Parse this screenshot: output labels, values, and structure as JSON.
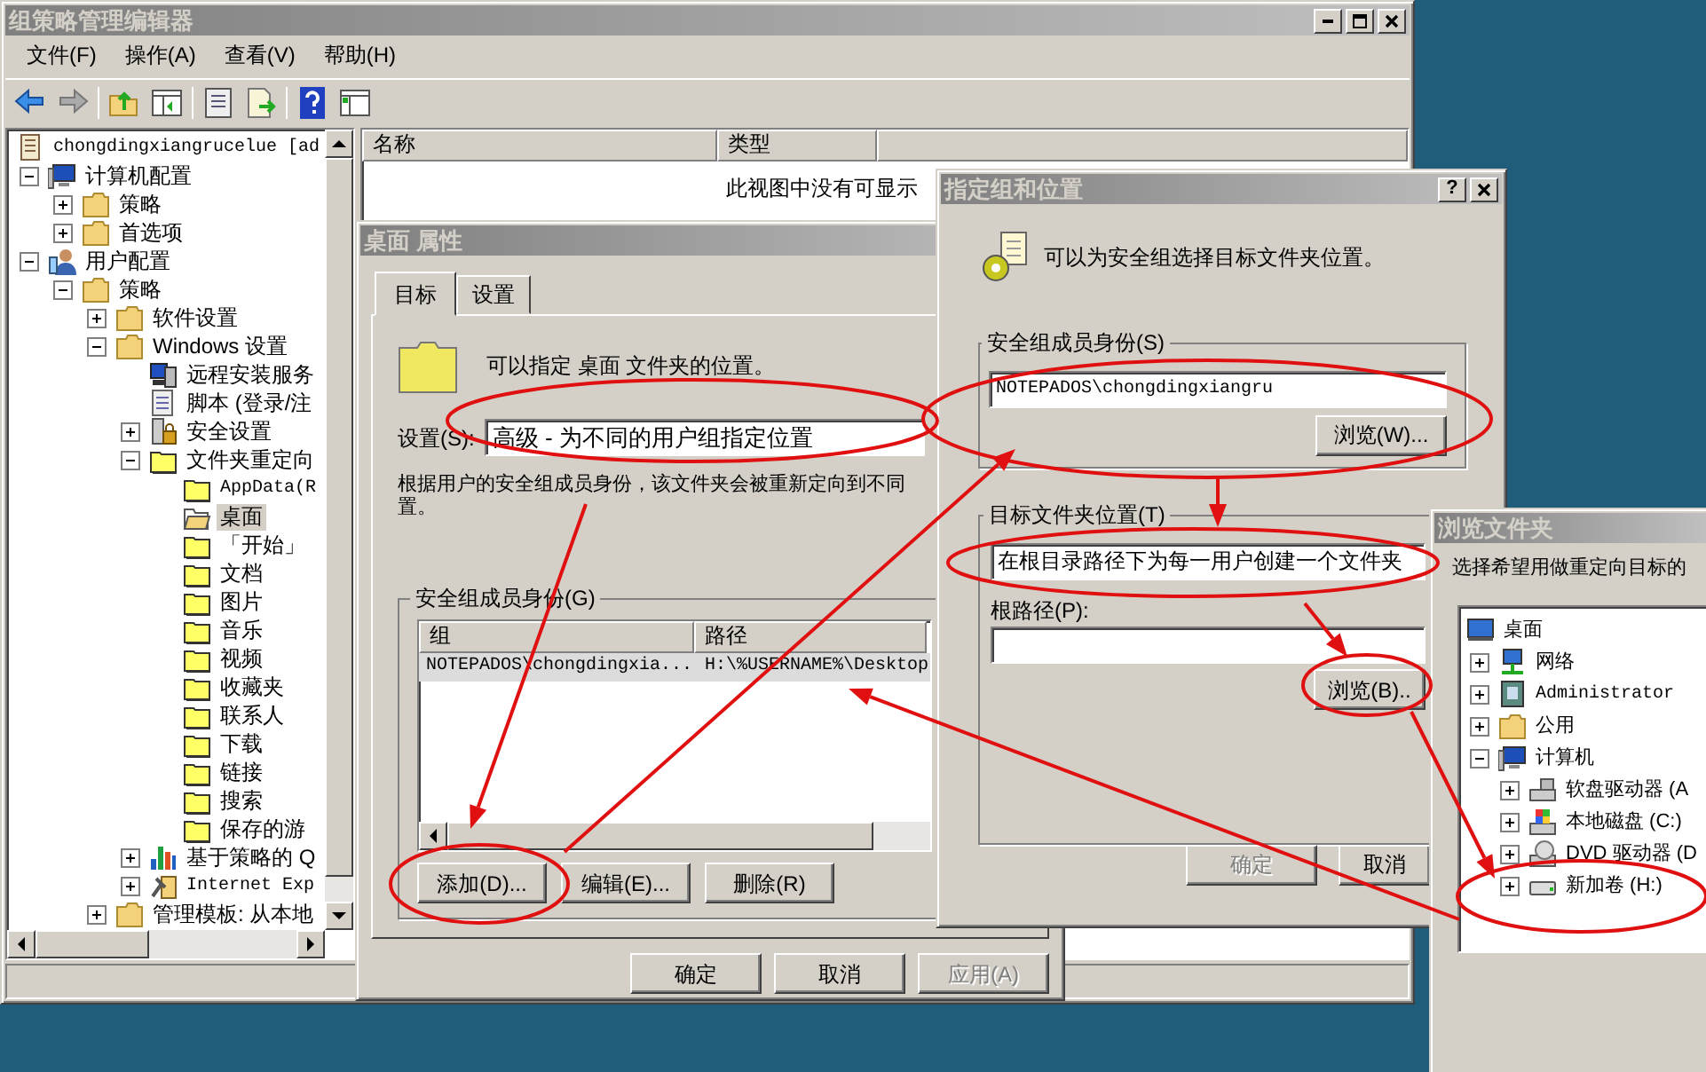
{
  "main_window": {
    "title": "组策略管理编辑器",
    "menu": [
      "文件(F)",
      "操作(A)",
      "查看(V)",
      "帮助(H)"
    ],
    "tree": [
      {
        "label": "chongdingxiangrucelue [ad",
        "kind": "policy",
        "selected": false,
        "children": [
          {
            "label": "计算机配置",
            "kind": "computer",
            "expanded": true,
            "selected": false,
            "children": [
              {
                "label": "策略",
                "kind": "folder",
                "expanded": false,
                "selected": false
              },
              {
                "label": "首选项",
                "kind": "folder",
                "expanded": false,
                "selected": false
              }
            ]
          },
          {
            "label": "用户配置",
            "kind": "user",
            "expanded": true,
            "selected": false,
            "children": [
              {
                "label": "策略",
                "kind": "folder",
                "expanded": true,
                "selected": false,
                "children": [
                  {
                    "label": "软件设置",
                    "kind": "folder",
                    "expanded": false,
                    "selected": false
                  },
                  {
                    "label": "Windows 设置",
                    "kind": "folder",
                    "expanded": true,
                    "selected": false,
                    "children": [
                      {
                        "label": "远程安装服务",
                        "kind": "install",
                        "selected": false
                      },
                      {
                        "label": "脚本 (登录/注",
                        "kind": "script",
                        "selected": false
                      },
                      {
                        "label": "安全设置",
                        "kind": "security",
                        "expanded": false,
                        "selected": false
                      },
                      {
                        "label": "文件夹重定向",
                        "kind": "smallfolder",
                        "expanded": true,
                        "selected": false,
                        "children": [
                          {
                            "label": "AppData(R",
                            "kind": "smallfolder",
                            "selected": false
                          },
                          {
                            "label": "桌面",
                            "kind": "openfolder",
                            "selected": true
                          },
                          {
                            "label": "「开始」",
                            "kind": "smallfolder",
                            "selected": false
                          },
                          {
                            "label": "文档",
                            "kind": "smallfolder",
                            "selected": false
                          },
                          {
                            "label": "图片",
                            "kind": "smallfolder",
                            "selected": false
                          },
                          {
                            "label": "音乐",
                            "kind": "smallfolder",
                            "selected": false
                          },
                          {
                            "label": "视频",
                            "kind": "smallfolder",
                            "selected": false
                          },
                          {
                            "label": "收藏夹",
                            "kind": "smallfolder",
                            "selected": false
                          },
                          {
                            "label": "联系人",
                            "kind": "smallfolder",
                            "selected": false
                          },
                          {
                            "label": "下载",
                            "kind": "smallfolder",
                            "selected": false
                          },
                          {
                            "label": "链接",
                            "kind": "smallfolder",
                            "selected": false
                          },
                          {
                            "label": "搜索",
                            "kind": "smallfolder",
                            "selected": false
                          },
                          {
                            "label": "保存的游",
                            "kind": "smallfolder",
                            "selected": false
                          }
                        ]
                      },
                      {
                        "label": "基于策略的 Q",
                        "kind": "chart",
                        "expanded": false,
                        "selected": false
                      },
                      {
                        "label": "Internet Exp",
                        "kind": "tools",
                        "expanded": false,
                        "selected": false
                      }
                    ]
                  },
                  {
                    "label": "管理模板: 从本地",
                    "kind": "folder",
                    "expanded": false,
                    "selected": false
                  }
                ]
              }
            ]
          }
        ]
      }
    ],
    "list_columns": [
      "名称",
      "类型"
    ],
    "empty_message": "此视图中没有可显示"
  },
  "properties_dialog": {
    "title": "桌面 属性",
    "tabs": [
      {
        "label": "目标",
        "selected": true
      },
      {
        "label": "设置",
        "selected": false
      }
    ],
    "intro": "可以指定 桌面 文件夹的位置。",
    "setting_label": "设置(S):",
    "setting_value": "高级 - 为不同的用户组指定位置",
    "description": [
      "根据用户的安全组成员身份，该文件夹会被重新定向到不同",
      "置。"
    ],
    "group_title": "安全组成员身份(G)",
    "columns": [
      "组",
      "路径"
    ],
    "rows": [
      {
        "cells": [
          "NOTEPADOS\\chongdingxia...",
          "H:\\%USERNAME%\\Desktop"
        ],
        "selected": true
      }
    ],
    "list_buttons": [
      "添加(D)...",
      "编辑(E)...",
      "删除(R)"
    ],
    "buttons": [
      {
        "label": "确定",
        "disabled": false
      },
      {
        "label": "取消",
        "disabled": false
      },
      {
        "label": "应用(A)",
        "disabled": true
      }
    ]
  },
  "group_dialog": {
    "title": "指定组和位置",
    "help": "?",
    "intro": "可以为安全组选择目标文件夹位置。",
    "membership_title": "安全组成员身份(S)",
    "membership_value": "NOTEPADOS\\chongdingxiangru",
    "membership_browse": "浏览(W)...",
    "target_title": "目标文件夹位置(T)",
    "target_value": "在根目录路径下为每一用户创建一个文件夹",
    "root_label": "根路径(P):",
    "root_browse": "浏览(B)..",
    "buttons": [
      {
        "label": "确定",
        "disabled": true
      },
      {
        "label": "取消",
        "disabled": false
      }
    ]
  },
  "browse_dialog": {
    "title": "浏览文件夹",
    "prompt": "选择希望用做重定向目标的",
    "tree": [
      {
        "label": "桌面",
        "kind": "desktop",
        "selected": false,
        "children": [
          {
            "label": "网络",
            "kind": "network",
            "expanded": false,
            "selected": false
          },
          {
            "label": "Administrator",
            "kind": "contact",
            "expanded": false,
            "selected": false
          },
          {
            "label": "公用",
            "kind": "folder",
            "expanded": false,
            "selected": false
          },
          {
            "label": "计算机",
            "kind": "computer",
            "expanded": true,
            "selected": false,
            "children": [
              {
                "label": "软盘驱动器 (A",
                "kind": "floppy",
                "expanded": false,
                "selected": false
              },
              {
                "label": "本地磁盘 (C:)",
                "kind": "disk",
                "expanded": false,
                "selected": false
              },
              {
                "label": "DVD 驱动器 (D",
                "kind": "dvd",
                "expanded": false,
                "selected": false
              },
              {
                "label": "新加卷 (H:)",
                "kind": "drive",
                "expanded": false,
                "selected": false
              }
            ]
          }
        ]
      }
    ]
  }
}
